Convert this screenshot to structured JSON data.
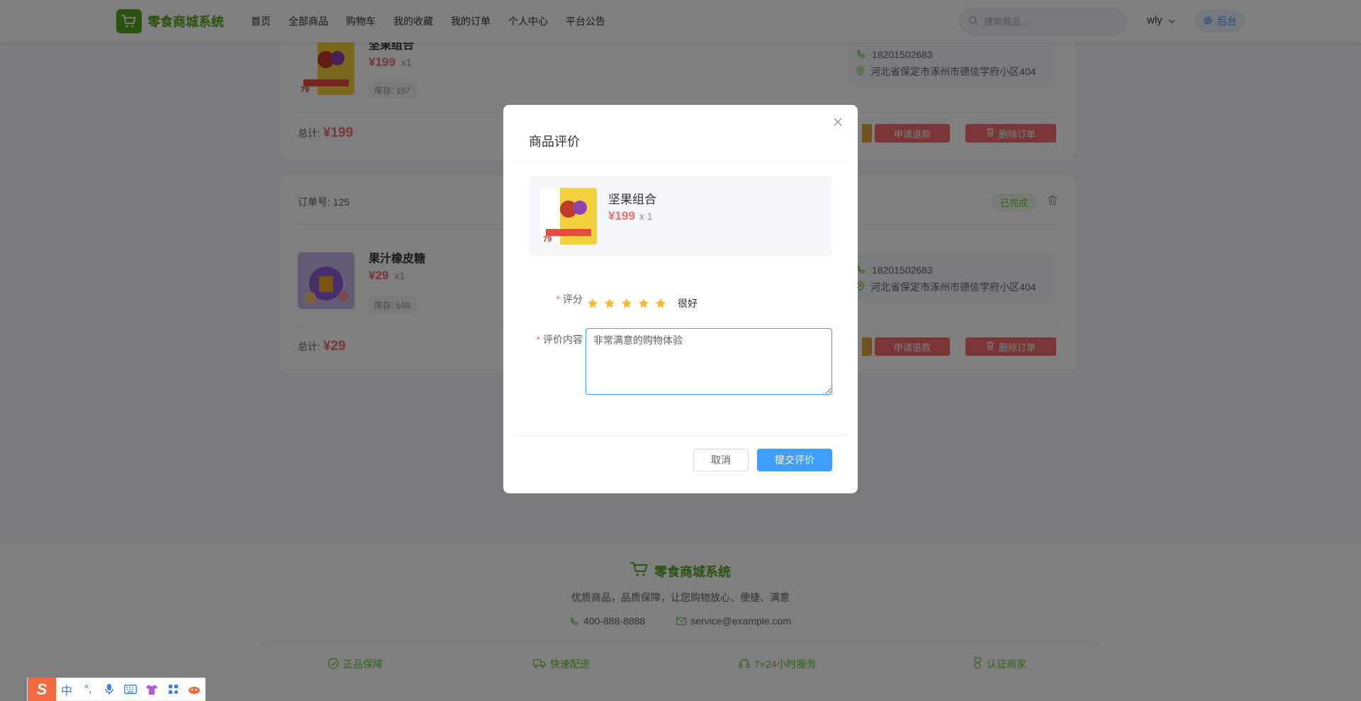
{
  "app": {
    "name": "零食商城系统"
  },
  "header": {
    "nav": [
      "首页",
      "全部商品",
      "购物车",
      "我的收藏",
      "我的订单",
      "个人中心",
      "平台公告"
    ],
    "search_placeholder": "搜索商品...",
    "username": "wly",
    "admin_label": "后台"
  },
  "orders": [
    {
      "product_name": "坚果组合",
      "price": "¥199",
      "qty": "x1",
      "stock": "库存: 197",
      "phone": "18201502683",
      "address": "河北省保定市涿州市德信学府小区404",
      "total_label": "总计:",
      "total": "¥199",
      "refund_label": "申请退款",
      "delete_label": "删除订单"
    },
    {
      "order_no": "订单号: 125",
      "status": "已完成",
      "product_name": "果汁橡皮糖",
      "price": "¥29",
      "qty": "x1",
      "stock": "库存: 598",
      "phone": "18201502683",
      "address": "河北省保定市涿州市德信学府小区404",
      "total_label": "总计:",
      "total": "¥29",
      "refund_label": "申请退款",
      "delete_label": "删除订单"
    }
  ],
  "footer": {
    "brand": "零食商城系统",
    "slogan": "优质商品，品质保障，让您购物放心、便捷、满意",
    "phone": "400-888-8888",
    "email": "service@example.com",
    "features": [
      "正品保障",
      "快速配送",
      "7×24小时服务",
      "认证商家"
    ]
  },
  "dialog": {
    "title": "商品评价",
    "product_name": "坚果组合",
    "price": "¥199",
    "qty": "x 1",
    "rating_label": "评分",
    "rating": 5,
    "rating_max": 5,
    "rating_text": "很好",
    "content_label": "评价内容",
    "content_value": "非常满意的购物体验",
    "cancel_label": "取消",
    "submit_label": "提交评价"
  },
  "ime": {
    "logo": "S",
    "mode": "中",
    "punct": "°,"
  },
  "colors": {
    "brand_green": "#52a61f",
    "price_red": "#f56c6c",
    "primary_blue": "#409eff",
    "star_orange": "#f7ba2a"
  }
}
